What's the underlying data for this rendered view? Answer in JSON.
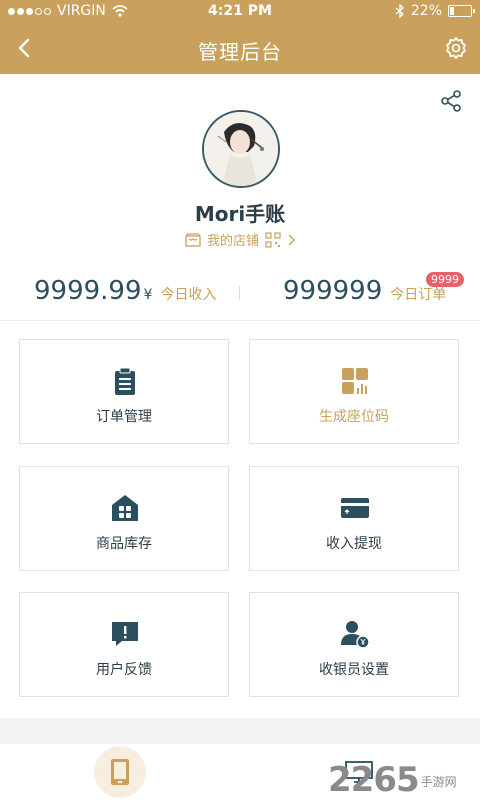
{
  "status_bar": {
    "carrier": "VIRGIN",
    "time": "4:21 PM",
    "battery": "22%"
  },
  "nav": {
    "title": "管理后台"
  },
  "profile": {
    "shop_name": "Mori手账",
    "my_shop_label": "我的店铺"
  },
  "stats": {
    "income_value": "9999.99",
    "income_currency": "¥",
    "income_label": "今日收入",
    "orders_value": "999999",
    "orders_label": "今日订单",
    "orders_badge": "9999"
  },
  "menu": [
    {
      "label": "订单管理",
      "icon": "clipboard-icon"
    },
    {
      "label": "生成座位码",
      "icon": "qrcode-icon"
    },
    {
      "label": "商品库存",
      "icon": "store-icon"
    },
    {
      "label": "收入提现",
      "icon": "card-icon"
    },
    {
      "label": "用户反馈",
      "icon": "feedback-icon"
    },
    {
      "label": "收银员设置",
      "icon": "cashier-icon"
    }
  ],
  "watermark": {
    "number": "2265",
    "text": "手游网"
  },
  "colors": {
    "accent": "#c9a05c",
    "primary": "#2c4f5f",
    "badge": "#e8606a"
  }
}
